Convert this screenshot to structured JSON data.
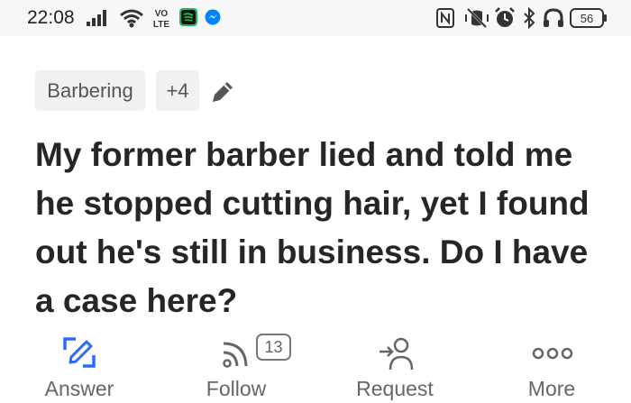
{
  "status_bar": {
    "time": "22:08",
    "volte": "VO\nLTE",
    "battery": "56"
  },
  "tags": [
    {
      "label": "Barbering"
    },
    {
      "label": "+4"
    }
  ],
  "question": {
    "title": "My former barber lied and told me he stopped cutting hair, yet I found out he's still in business. Do I have a case here?"
  },
  "actions": {
    "answer_label": "Answer",
    "follow_label": "Follow",
    "follow_count": "13",
    "request_label": "Request",
    "more_label": "More"
  },
  "colors": {
    "accent": "#2e69ff",
    "icon_gray": "#666666",
    "spotify": "#1db954",
    "messenger": "#0084ff"
  }
}
